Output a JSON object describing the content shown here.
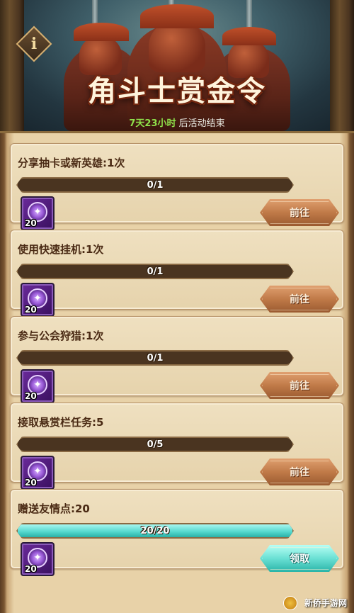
{
  "event": {
    "title": "角斗士赏金令",
    "countdown_time": "7天23小时",
    "countdown_suffix": " 后活动结束",
    "info_glyph": "i"
  },
  "tasks": [
    {
      "title": "分享抽卡或新英雄:1次",
      "progress_text": "0/1",
      "progress": 0.0,
      "reward_qty": "20",
      "button": "前往",
      "state": "go"
    },
    {
      "title": "使用快速挂机:1次",
      "progress_text": "0/1",
      "progress": 0.0,
      "reward_qty": "20",
      "button": "前往",
      "state": "go"
    },
    {
      "title": "参与公会狩猎:1次",
      "progress_text": "0/1",
      "progress": 0.0,
      "reward_qty": "20",
      "button": "前往",
      "state": "go"
    },
    {
      "title": "接取悬赏栏任务:5",
      "progress_text": "0/5",
      "progress": 0.0,
      "reward_qty": "20",
      "button": "前往",
      "state": "go"
    },
    {
      "title": "赠送友情点:20",
      "progress_text": "20/20",
      "progress": 1.0,
      "reward_qty": "20",
      "button": "领取",
      "state": "claim"
    }
  ],
  "icons": {
    "reward": "purple-summon-scroll-icon",
    "info": "info-icon"
  },
  "colors": {
    "progress_fill": "#52d6cc",
    "go_button": "#c07a48",
    "claim_button": "#6ae0d4",
    "countdown": "#8ee04a"
  },
  "watermark": "新侨手游网"
}
